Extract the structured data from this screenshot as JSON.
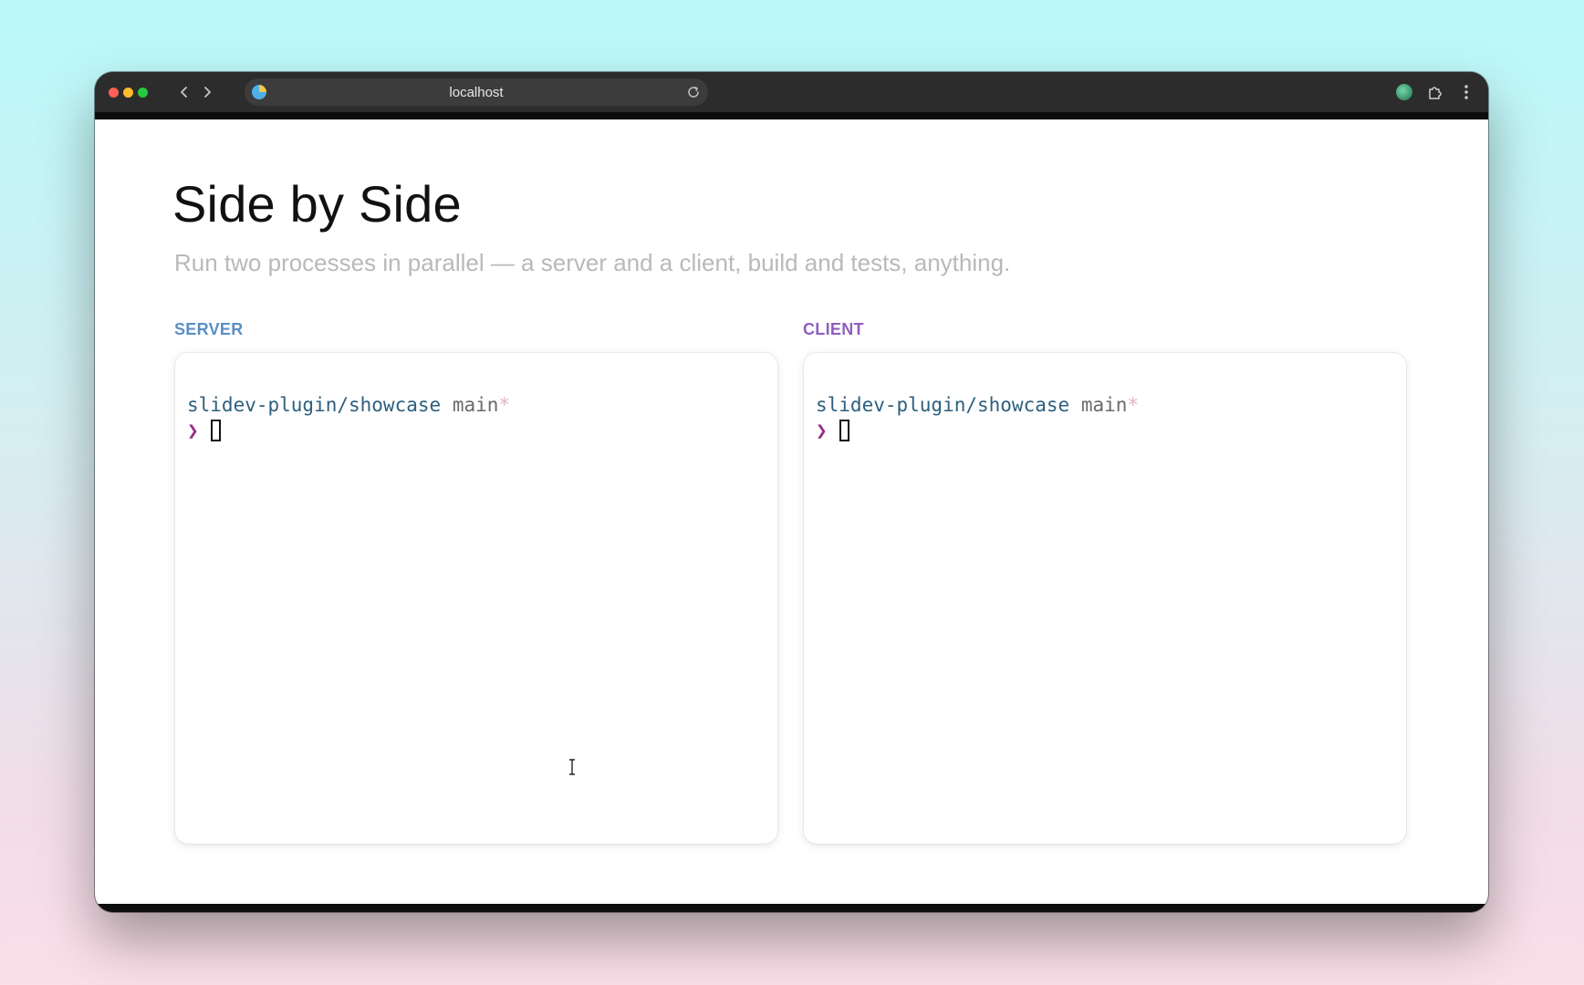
{
  "browser": {
    "url": "localhost",
    "icons": {
      "back": "chevron-left-icon",
      "forward": "chevron-right-icon",
      "reload": "reload-icon",
      "profile": "profile-icon",
      "extensions": "puzzle-icon",
      "menu": "more-vertical-icon"
    }
  },
  "slide": {
    "title": "Side by Side",
    "subtitle": "Run two processes in parallel — a server and a client, build and tests, anything."
  },
  "panels": [
    {
      "label": "SERVER",
      "accent": "#5a8fc4",
      "path": "slidev-plugin/showcase",
      "branch": "main",
      "dirty": "*",
      "prompt": "❯"
    },
    {
      "label": "CLIENT",
      "accent": "#8f5fc0",
      "path": "slidev-plugin/showcase",
      "branch": "main",
      "dirty": "*",
      "prompt": "❯"
    }
  ]
}
